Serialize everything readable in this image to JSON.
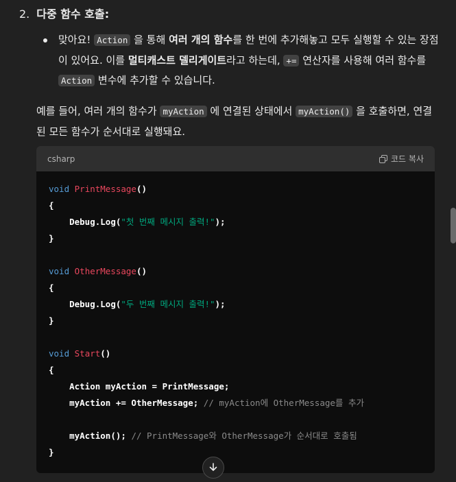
{
  "heading": {
    "number": "2.",
    "title": "다중 함수 호출:"
  },
  "bullet": {
    "t1": "맞아요! ",
    "c1": "Action",
    "t2": " 을 통해 ",
    "b1": "여러 개의 함수",
    "t3": "를 한 번에 추가해놓고 모두 실행할 수 있는 장점이 있어요. 이를 ",
    "b2": "멀티캐스트 델리게이트",
    "t4": "라고 하는데, ",
    "c2": "+=",
    "t5": " 연산자를 사용해 여러 함수를 ",
    "c3": "Action",
    "t6": " 변수에 추가할 수 있습니다."
  },
  "para": {
    "t1": "예를 들어, 여러 개의 함수가 ",
    "c1": "myAction",
    "t2": " 에 연결된 상태에서 ",
    "c2": "myAction()",
    "t3": " 을 호출하면, 연결된 모든 함수가 순서대로 실행돼요."
  },
  "codeblock": {
    "language": "csharp",
    "copy_label": "코드 복사",
    "lines": {
      "kw_void": "void",
      "fn_print": "PrintMessage",
      "parens": "()",
      "brace_open": "{",
      "brace_close": "}",
      "debug_log": "Debug.Log(",
      "str1": "\"첫 번째 메시지 출력!\"",
      "close_call": ");",
      "fn_other": "OtherMessage",
      "str2": "\"두 번째 메시지 출력!\"",
      "fn_start": "Start",
      "assign": "Action myAction = PrintMessage;",
      "add": "myAction += OtherMessage;",
      "comment1": "// myAction에 OtherMessage를 추가",
      "invoke": "myAction();",
      "comment2": "// PrintMessage와 OtherMessage가 순서대로 호출됨"
    }
  },
  "icons": {
    "copy": "copy-icon",
    "scroll_down": "arrow-down-icon"
  }
}
